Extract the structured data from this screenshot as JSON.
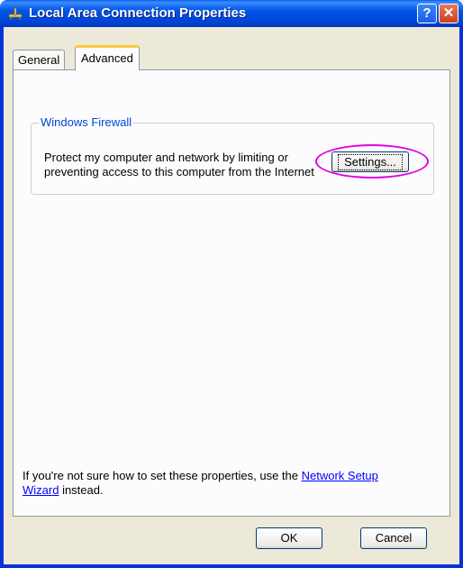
{
  "window": {
    "title": "Local Area Connection Properties",
    "help_icon_char": "?",
    "close_icon_char": "✕",
    "title_icon": "network-connection-icon"
  },
  "tabs": [
    {
      "label": "General",
      "selected": false
    },
    {
      "label": "Advanced",
      "selected": true
    }
  ],
  "firewall": {
    "group_label": "Windows Firewall",
    "description": "Protect my computer and network by limiting or preventing access to this computer from the Internet",
    "settings_button": "Settings...",
    "highlight_color": "#e000e0"
  },
  "help": {
    "text_before": "If you're not sure how to set these properties, use the ",
    "link_text": "Network Setup Wizard",
    "text_after": " instead."
  },
  "buttons": {
    "ok": "OK",
    "cancel": "Cancel"
  },
  "colors": {
    "titlebar": "#0055e5",
    "dialog_bg": "#ece9d8",
    "group_label": "#0046d5",
    "tab_accent": "#ffc83c",
    "link": "#0000ff"
  }
}
